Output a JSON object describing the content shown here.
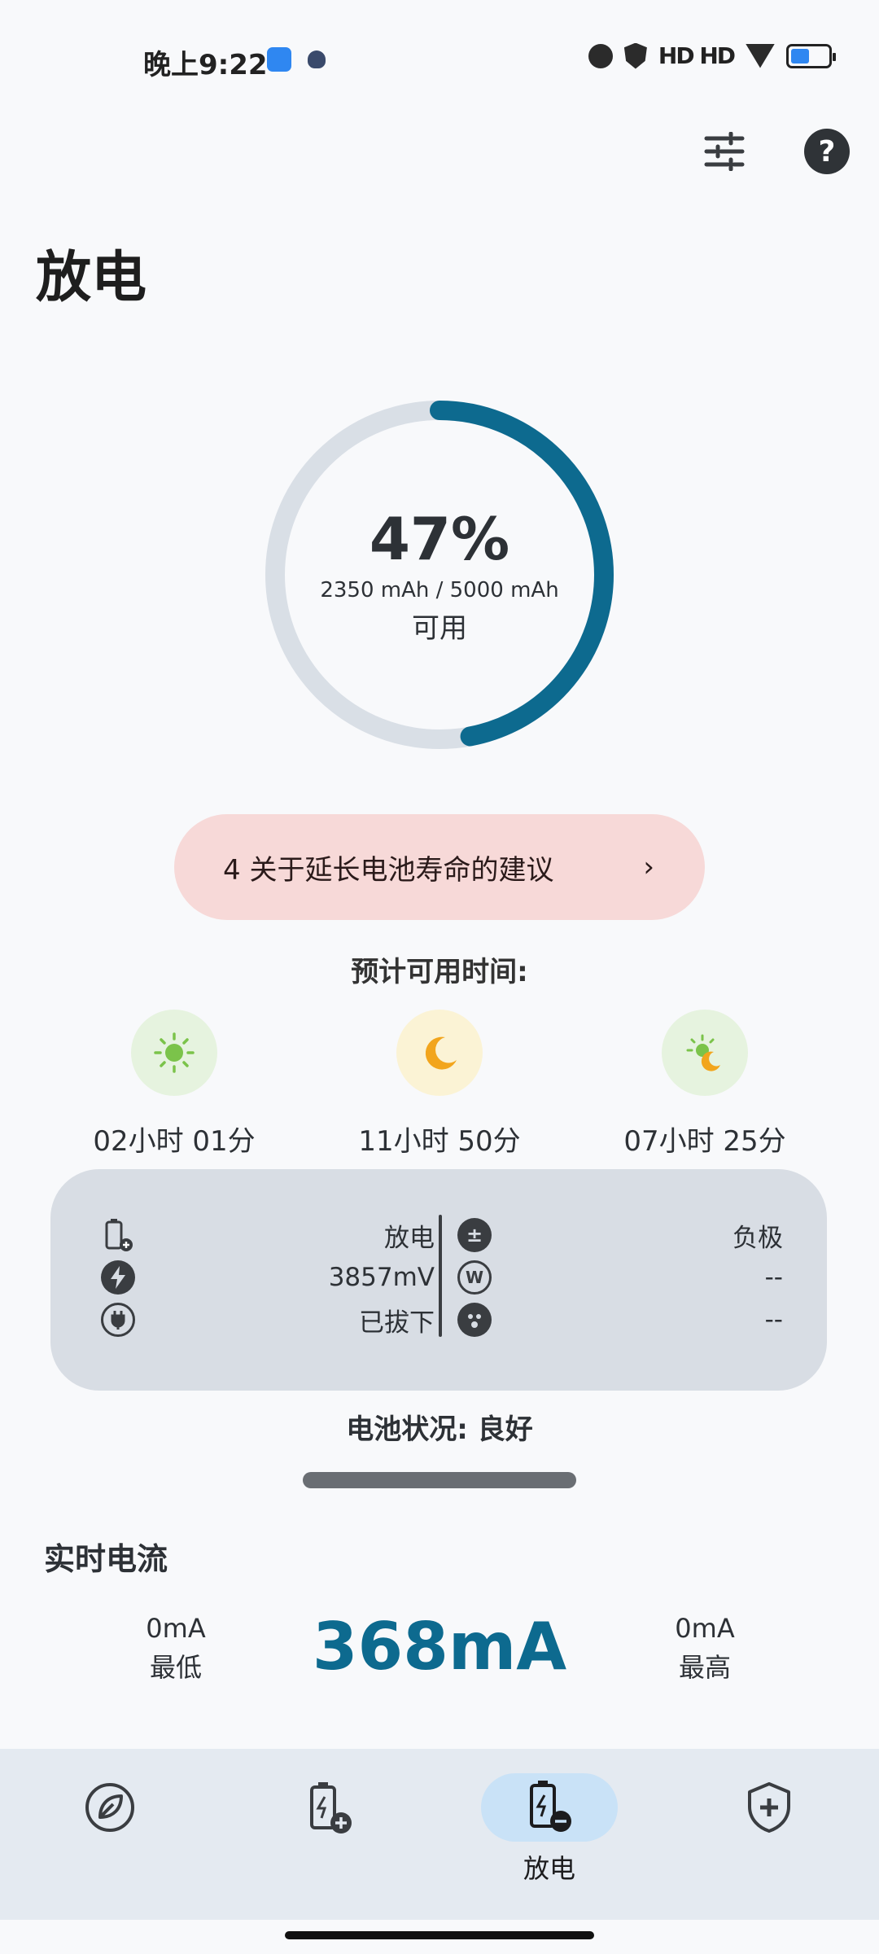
{
  "status": {
    "time": "晚上9:22",
    "signal": "HD HD",
    "battery_level": 0.5
  },
  "header": {
    "title": "放电",
    "icons": [
      "tune-icon",
      "help-icon"
    ]
  },
  "gauge": {
    "percent_text": "47%",
    "percent_value": 47,
    "capacity": "2350 mAh / 5000 mAh",
    "label": "可用"
  },
  "tips": {
    "text": "4 关于延长电池寿命的建议",
    "chevron": "›"
  },
  "estimate": {
    "title": "预计可用时间:",
    "items": [
      {
        "icon": "sun-icon",
        "time": "02小时 01分"
      },
      {
        "icon": "moon-icon",
        "time": "11小时 50分"
      },
      {
        "icon": "sun-moon-icon",
        "time": "07小时 25分"
      }
    ]
  },
  "info": {
    "left": [
      {
        "icon": "battery-plus-icon",
        "value": "放电"
      },
      {
        "icon": "bolt-icon",
        "value": "3857mV"
      },
      {
        "icon": "plug-icon",
        "value": "已拔下"
      }
    ],
    "right": [
      {
        "icon": "polarity-icon",
        "value": "负极"
      },
      {
        "icon": "watt-icon",
        "value": "--"
      },
      {
        "icon": "face-icon",
        "value": "--"
      }
    ]
  },
  "health": {
    "text": "电池状况: 良好"
  },
  "current": {
    "title": "实时电流",
    "min_value": "0mA",
    "min_label": "最低",
    "now_value": "368mA",
    "max_value": "0mA",
    "max_label": "最高"
  },
  "nav": {
    "items": [
      {
        "icon": "leaf-icon",
        "label": ""
      },
      {
        "icon": "battery-charge-icon",
        "label": ""
      },
      {
        "icon": "battery-discharge-icon",
        "label": "放电"
      },
      {
        "icon": "shield-plus-icon",
        "label": ""
      }
    ],
    "active_index": 2
  },
  "colors": {
    "accent": "#0d6a8f",
    "gauge_track": "#d9dfe6",
    "tips_bg": "#f7d9d8",
    "card_bg": "#d8dde4",
    "nav_bg": "#e4eaf1",
    "nav_active": "#c9e2f7"
  }
}
